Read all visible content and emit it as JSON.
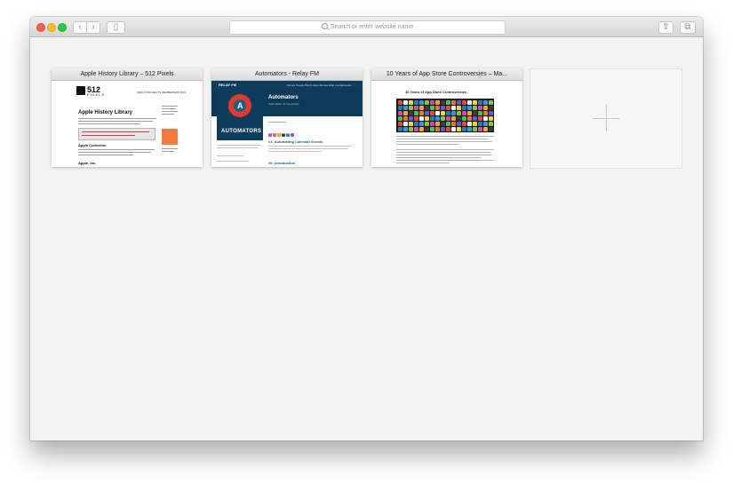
{
  "toolbar": {
    "address_placeholder": "Search or enter website name",
    "back_glyph": "‹",
    "forward_glyph": "›",
    "sidebar_glyph": "▯",
    "share_glyph": "⇪",
    "tabs_glyph": "⧉"
  },
  "tabs": [
    {
      "title": "Apple History Library – 512 Pixels",
      "thumb": {
        "logo_number": "512",
        "logo_word": "PIXELS",
        "nav": "ABOUT   PROJECTS   MEMBERSHIP   RSS",
        "heading": "Apple History Library",
        "section1": "Apple Collection",
        "section2": "Apple, Inc."
      }
    },
    {
      "title": "Automators - Relay FM",
      "thumb": {
        "nav_logo": "RELAY FM",
        "nav_items": "Shows   People   Merch   Apps   Membership   Live   Episodes",
        "show_title": "Automators",
        "show_subtitle": "Automation for the people",
        "wordmark": "AUTOMATORS",
        "episode1": "#1: Automating Calendar Events",
        "episode2": "#0: Introduction"
      }
    },
    {
      "title": "10 Years of App Store Controversies – Ma...",
      "thumb": {
        "heading": "10 Years of App Store Controversies"
      }
    }
  ],
  "new_tab": {
    "icon": "plus-icon"
  },
  "colors": {
    "window_bg": "#f3f3f3",
    "relay_blue": "#0d3c5c",
    "automators_red": "#e03a2c",
    "ad_orange": "#f27a3e"
  }
}
